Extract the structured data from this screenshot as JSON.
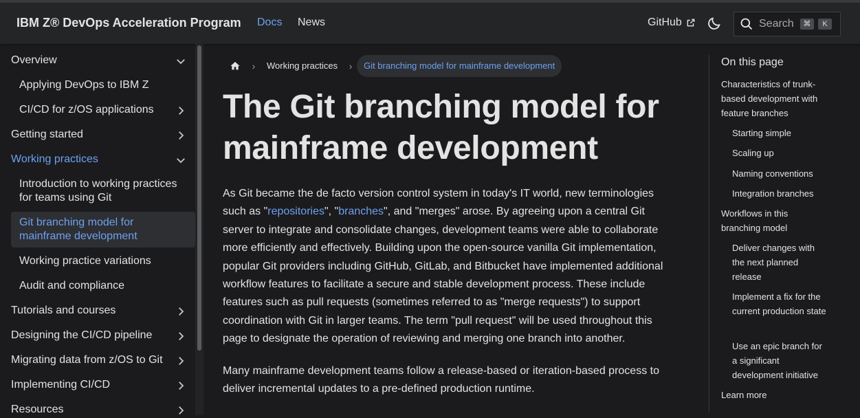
{
  "navbar": {
    "brand": "IBM Z® DevOps Acceleration Program",
    "links": [
      {
        "label": "Docs",
        "active": true
      },
      {
        "label": "News",
        "active": false
      }
    ],
    "github_label": "GitHub",
    "search_placeholder": "Search",
    "search_keys": [
      "⌘",
      "K"
    ]
  },
  "sidebar": {
    "items": [
      {
        "label": "Overview",
        "level": 1,
        "chevron": "down"
      },
      {
        "label": "Applying DevOps to IBM Z",
        "level": 2
      },
      {
        "label": "CI/CD for z/OS applications",
        "level": 2,
        "chevron": "right"
      },
      {
        "label": "Getting started",
        "level": 1,
        "chevron": "right"
      },
      {
        "label": "Working practices",
        "level": 1,
        "chevron": "down",
        "active": true
      },
      {
        "label": "Introduction to working practices for teams using Git",
        "level": 2
      },
      {
        "label": "Git branching model for mainframe development",
        "level": 2,
        "current": true
      },
      {
        "label": "Working practice variations",
        "level": 2
      },
      {
        "label": "Audit and compliance",
        "level": 2
      },
      {
        "label": "Tutorials and courses",
        "level": 1,
        "chevron": "right"
      },
      {
        "label": "Designing the CI/CD pipeline",
        "level": 1,
        "chevron": "right"
      },
      {
        "label": "Migrating data from z/OS to Git",
        "level": 1,
        "chevron": "right"
      },
      {
        "label": "Implementing CI/CD",
        "level": 1,
        "chevron": "right"
      },
      {
        "label": "Resources",
        "level": 1,
        "chevron": "right"
      }
    ]
  },
  "breadcrumbs": {
    "items": [
      "Working practices",
      "Git branching model for mainframe development"
    ]
  },
  "article": {
    "title": "The Git branching model for mainframe development",
    "p1_a": "As Git became the de facto version control system in today's IT world, new terminologies such as \"",
    "p1_link1": "repositories",
    "p1_b": "\", \"",
    "p1_link2": "branches",
    "p1_c": "\", and \"merges\" arose. By agreeing upon a central Git server to integrate and consolidate changes, development teams were able to collaborate more efficiently and effectively. Building upon the open-source vanilla Git implementation, popular Git providers including GitHub, GitLab, and Bitbucket have implemented additional workflow features to facilitate a secure and stable development process. These include features such as pull requests (sometimes referred to as \"merge requests\") to support coordination with Git in larger teams. The term \"pull request\" will be used throughout this page to designate the operation of reviewing and merging one branch into another.",
    "p2": "Many mainframe development teams follow a release-based or iteration-based process to deliver incremental updates to a pre-defined production runtime."
  },
  "toc": {
    "title": "On this page",
    "items": [
      {
        "label": "Characteristics of trunk-based development with feature branches",
        "level": 1
      },
      {
        "label": "Starting simple",
        "level": 2
      },
      {
        "label": "Scaling up",
        "level": 2
      },
      {
        "label": "Naming conventions",
        "level": 2
      },
      {
        "label": "Integration branches",
        "level": 2
      },
      {
        "label": "Workflows in this branching model",
        "level": 1
      },
      {
        "label": "Deliver changes with the next planned release",
        "level": 2
      },
      {
        "label": "Implement a fix for the current production state",
        "level": 2
      },
      {
        "label": "Use an epic branch for a significant development initiative",
        "level": 2
      },
      {
        "label": "Learn more",
        "level": 1
      }
    ]
  },
  "colors": {
    "background": "#1b1b1d",
    "navbar": "#242526",
    "accent": "#6ea0f0",
    "text": "#e3e3e3"
  }
}
